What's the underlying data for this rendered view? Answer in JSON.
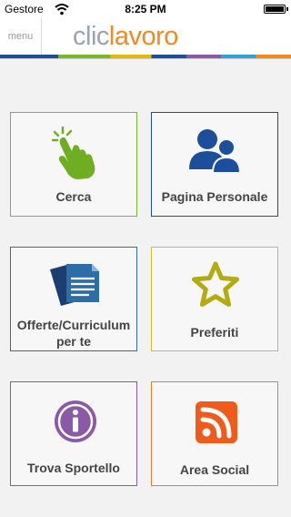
{
  "status_bar": {
    "carrier": "Gestore",
    "time": "8:25 PM"
  },
  "header": {
    "menu_label": "menu",
    "logo_part1": "clic",
    "logo_part2": "lavoro"
  },
  "tiles": [
    {
      "label": "Cerca",
      "icon": "hand-pointer-icon",
      "color": "#6fae23"
    },
    {
      "label": "Pagina Personale",
      "icon": "users-icon",
      "color": "#1c4e9c"
    },
    {
      "label": "Offerte/Curriculum per te",
      "icon": "documents-icon",
      "color": "#2d6ea8"
    },
    {
      "label": "Preferiti",
      "icon": "star-icon",
      "color": "#c8c41a"
    },
    {
      "label": "Trova Sportello",
      "icon": "info-icon",
      "color": "#8a5aa6"
    },
    {
      "label": "Area Social",
      "icon": "rss-icon",
      "color": "#f05a1a"
    }
  ]
}
